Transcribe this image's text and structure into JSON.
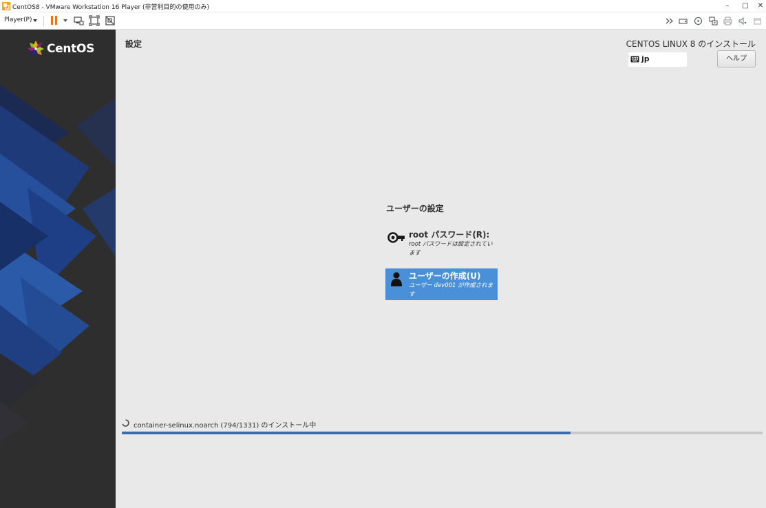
{
  "window": {
    "title": "CentOS8 - VMware Workstation 16 Player (非営利目的の使用のみ)",
    "min": "–",
    "max": "□",
    "close": "✕"
  },
  "toolbar": {
    "player_label": "Player(P)",
    "pause_color": "#e8741e",
    "icons": [
      "pause-icon",
      "send-ctrl-alt-del-icon",
      "fullscreen-icon",
      "unity-icon",
      "connect-drive-icon",
      "network-icon",
      "usb-icon",
      "printer-icon",
      "sound-icon",
      "hide-toolbar-icon"
    ]
  },
  "installer": {
    "brand": "CentOS",
    "section_title": "設定",
    "install_title": "CENTOS LINUX 8 のインストール",
    "keyboard_layout": "jp",
    "help_label": "ヘルプ",
    "user_settings_heading": "ユーザーの設定",
    "spokes": {
      "root": {
        "title": "root パスワード(R):",
        "status": "root パスワードは設定されています"
      },
      "user": {
        "title": "ユーザーの作成(U)",
        "status": "ユーザー dev001 が作成されます"
      }
    },
    "progress": {
      "text": "container-selinux.noarch (794/1331) のインストール中",
      "current": 794,
      "total": 1331,
      "fraction": 0.7
    },
    "accent_color": "#4a90d9"
  }
}
